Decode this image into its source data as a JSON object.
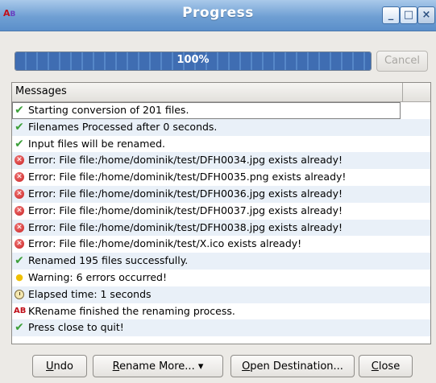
{
  "window": {
    "title": "Progress",
    "icon": "krename-app-icon",
    "controls": {
      "minimize": "_",
      "maximize": "□",
      "close": "×"
    }
  },
  "progress": {
    "percent": 100,
    "label": "100%",
    "cancel_label": "Cancel",
    "cancel_enabled": false
  },
  "messages": {
    "header": "Messages",
    "rows": [
      {
        "icon": "check",
        "text": "Starting conversion of 201 files."
      },
      {
        "icon": "check",
        "text": "Filenames Processed after 0 seconds."
      },
      {
        "icon": "check",
        "text": "Input files will be renamed."
      },
      {
        "icon": "error",
        "text": "Error: File file:/home/dominik/test/DFH0034.jpg exists already!"
      },
      {
        "icon": "error",
        "text": "Error: File file:/home/dominik/test/DFH0035.png exists already!"
      },
      {
        "icon": "error",
        "text": "Error: File file:/home/dominik/test/DFH0036.jpg exists already!"
      },
      {
        "icon": "error",
        "text": "Error: File file:/home/dominik/test/DFH0037.jpg exists already!"
      },
      {
        "icon": "error",
        "text": "Error: File file:/home/dominik/test/DFH0038.jpg exists already!"
      },
      {
        "icon": "error",
        "text": "Error: File file:/home/dominik/test/X.ico exists already!"
      },
      {
        "icon": "check",
        "text": "Renamed 195 files successfully."
      },
      {
        "icon": "warning",
        "text": "Warning: 6 errors occurred!"
      },
      {
        "icon": "clock",
        "text": "Elapsed time: 1 seconds"
      },
      {
        "icon": "krename",
        "text": "KRename finished the renaming process."
      },
      {
        "icon": "check",
        "text": "Press close to quit!"
      }
    ]
  },
  "buttons": {
    "undo": {
      "mnemonic": "U",
      "rest": "ndo"
    },
    "rename_more": {
      "mnemonic": "R",
      "rest": "ename More...",
      "arrow": "▾"
    },
    "open_destination": {
      "mnemonic": "O",
      "rest": "pen Destination..."
    },
    "close": {
      "mnemonic": "C",
      "rest": "lose"
    }
  },
  "colors": {
    "titlebar": "#6f9fd3",
    "progress_fill": "#3f6db2",
    "row_alt": "#e9f0f8",
    "success": "#3da03a",
    "error": "#c81e1e",
    "warning": "#e8b400"
  }
}
